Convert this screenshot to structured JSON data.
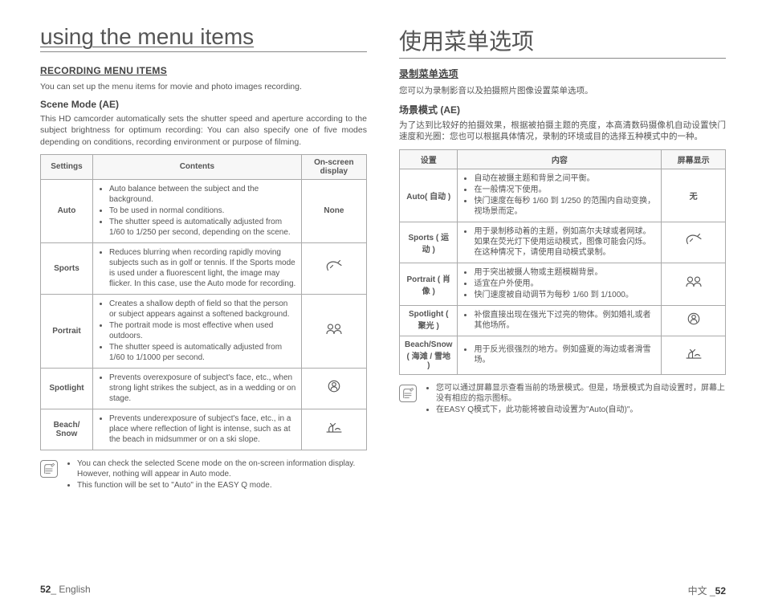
{
  "left": {
    "title": "using the menu items",
    "section_title": "RECORDING MENU ITEMS",
    "intro": "You can set up the menu items for movie and photo images recording.",
    "sub_title": "Scene Mode (AE)",
    "desc": "This HD camcorder automatically sets the shutter speed and aperture according to the subject brightness for optimum recording: You can also specify one of five modes depending on conditions, recording environment or purpose of filming.",
    "headers": {
      "settings": "Settings",
      "contents": "Contents",
      "display": "On-screen display"
    },
    "rows": [
      {
        "setting": "Auto",
        "items": [
          "Auto balance between the subject and the background.",
          "To be used in normal conditions.",
          "The shutter speed is automatically adjusted from 1/60 to 1/250 per second, depending on the scene."
        ],
        "display_text": "None"
      },
      {
        "setting": "Sports",
        "items": [
          "Reduces blurring when recording rapidly moving subjects such as in golf or tennis. If the Sports mode is used under a fluorescent light, the image may flicker. In this case, use the Auto mode for recording."
        ],
        "display_icon": "sports"
      },
      {
        "setting": "Portrait",
        "items": [
          "Creates a shallow depth of field so that the person or subject appears against a softened background.",
          "The portrait mode is most effective when used outdoors.",
          "The shutter speed is automatically adjusted from 1/60 to 1/1000 per second."
        ],
        "display_icon": "portrait"
      },
      {
        "setting": "Spotlight",
        "items": [
          "Prevents overexposure of subject's face, etc., when strong light strikes the subject, as in a wedding or on stage."
        ],
        "display_icon": "spotlight"
      },
      {
        "setting": "Beach/ Snow",
        "items": [
          "Prevents underexposure of subject's face, etc., in a place where reflection of light is intense, such as at the beach in midsummer or on a ski slope."
        ],
        "display_icon": "beach"
      }
    ],
    "notes": [
      "You can check the selected Scene mode on the on-screen information display. However, nothing will appear in Auto mode.",
      "This function will be set to \"Auto\" in the EASY Q mode."
    ],
    "footer_page": "52",
    "footer_lang": "_ English"
  },
  "right": {
    "title": "使用菜单选项",
    "section_title": "录制菜单选项",
    "intro": "您可以为录制影音以及拍摄照片图像设置菜单选项。",
    "sub_title": "场景模式 (AE)",
    "desc": "为了达到比较好的拍摄效果，根据被拍摄主题的亮度，本高清数码摄像机自动设置快门速度和光圈：您也可以根据具体情况，录制的环境或目的选择五种模式中的一种。",
    "headers": {
      "settings": "设置",
      "contents": "内容",
      "display": "屏幕显示"
    },
    "rows": [
      {
        "setting": "Auto( 自动 )",
        "items": [
          "自动在被摄主题和背景之间平衡。",
          "在一般情况下使用。",
          "快门速度在每秒 1/60 到 1/250 的范围内自动变换，视场景而定。"
        ],
        "display_text": "无"
      },
      {
        "setting": "Sports ( 运动 )",
        "items": [
          "用于录制移动着的主题，例如高尔夫球或者网球。如果在荧光灯下使用运动模式，图像可能会闪烁。在这种情况下，请使用自动模式录制。"
        ],
        "display_icon": "sports"
      },
      {
        "setting": "Portrait ( 肖像 )",
        "items": [
          "用于突出被摄人物或主题模糊背景。",
          "适宜在户外使用。",
          "快门速度被自动调节为每秒 1/60 到 1/1000。"
        ],
        "display_icon": "portrait"
      },
      {
        "setting": "Spotlight ( 聚光 )",
        "items": [
          "补偿直接出现在强光下过亮的物体。例如婚礼或者其他场所。"
        ],
        "display_icon": "spotlight"
      },
      {
        "setting": "Beach/Snow ( 海滩 / 雪地 )",
        "items": [
          "用于反光很强烈的地方。例如盛夏的海边或者滑雪场。"
        ],
        "display_icon": "beach"
      }
    ],
    "notes": [
      "您可以通过屏幕显示查看当前的场景模式。但是，场景模式为自动设置时，屏幕上没有相应的指示图标。",
      "在EASY Q模式下，此功能将被自动设置为\"Auto(自动)\"。"
    ],
    "footer_lang": "中文 _",
    "footer_page": "52"
  },
  "icons": {
    "sports": "sports-icon",
    "portrait": "portrait-icon",
    "spotlight": "spotlight-icon",
    "beach": "beach-snow-icon"
  }
}
